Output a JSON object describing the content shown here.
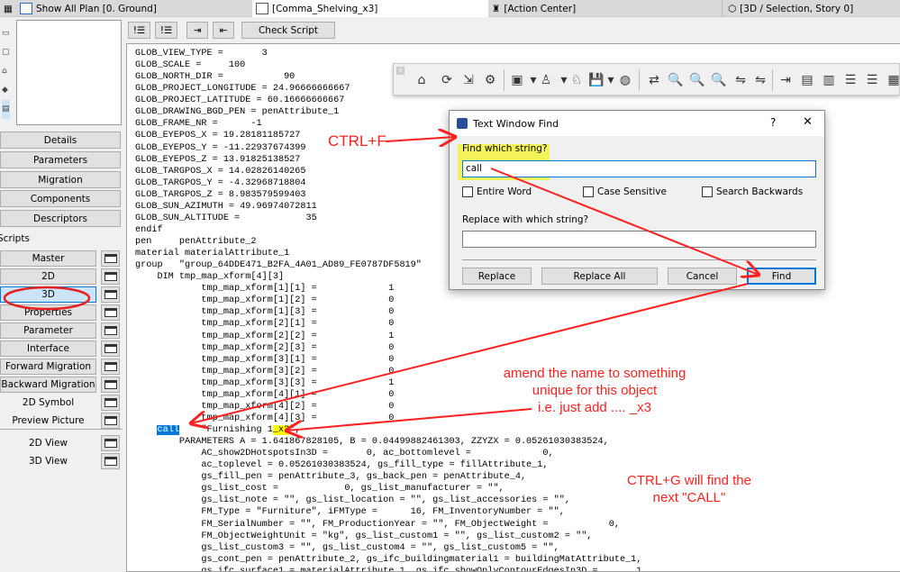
{
  "tabs": [
    {
      "label": "Show All Plan [0. Ground]",
      "icon": "floor-plan-icon"
    },
    {
      "label": "[Comma_Shelving_x3]",
      "icon": "gdl-object-icon",
      "active": true
    },
    {
      "label": "[Action Center]",
      "icon": "lighthouse-icon"
    },
    {
      "label": "[3D / Selection, Story 0]",
      "icon": "cube-icon"
    }
  ],
  "sidebar": {
    "sections": [
      "Details",
      "Parameters",
      "Migration",
      "Components",
      "Descriptors"
    ],
    "scripts_label": "Scripts",
    "scripts": [
      "Master",
      "2D",
      "3D",
      "Properties",
      "Parameter",
      "Interface",
      "Forward Migration",
      "Backward Migration",
      "2D Symbol",
      "Preview Picture"
    ],
    "selected_script": "3D",
    "views": [
      "2D View",
      "3D View"
    ]
  },
  "editor_toolbar": {
    "check_script": "Check Script"
  },
  "code": {
    "lines_before": [
      "GLOB_VIEW_TYPE =       3",
      "GLOB_SCALE =     100",
      "GLOB_NORTH_DIR =           90",
      "GLOB_PROJECT_LONGITUDE = 24.96666666667",
      "GLOB_PROJECT_LATITUDE = 60.16666666667",
      "GLOB_DRAWING_BGD_PEN = penAttribute_1",
      "GLOB_FRAME_NR =      -1",
      "GLOB_EYEPOS_X = 19.28181185727",
      "GLOB_EYEPOS_Y = -11.22937674399",
      "GLOB_EYEPOS_Z = 13.91825138527",
      "GLOB_TARGPOS_X = 14.02826140265",
      "GLOB_TARGPOS_Y = -4.32968718804",
      "GLOB_TARGPOS_Z = 8.983579599403",
      "GLOB_SUN_AZIMUTH = 49.96974072811",
      "GLOB_SUN_ALTITUDE =            35",
      "endif",
      "pen     penAttribute_2",
      "material materialAttribute_1",
      "group   \"group_64DDE471_B2FA_4A01_AD89_FE0787DF5819\"",
      "    DIM tmp_map_xform[4][3]",
      "            tmp_map_xform[1][1] =             1",
      "            tmp_map_xform[1][2] =             0",
      "            tmp_map_xform[1][3] =             0",
      "            tmp_map_xform[2][1] =             0",
      "            tmp_map_xform[2][2] =             1",
      "            tmp_map_xform[2][3] =             0",
      "            tmp_map_xform[3][1] =             0",
      "            tmp_map_xform[3][2] =             0",
      "            tmp_map_xform[3][3] =             1",
      "            tmp_map_xform[4][1] =             0",
      "            tmp_map_xform[4][2] =             0",
      "            tmp_map_xform[4][3] =             0"
    ],
    "call_line": {
      "indent": "    ",
      "keyword": "call",
      "mid": "    \"Furnishing 1",
      "highlight": "_x3",
      "end": "\","
    },
    "lines_after": [
      "        PARAMETERS A = 1.641867828105, B = 0.04499882461303, ZZYZX = 0.05261030383524,",
      "            AC_show2DHotspotsIn3D =       0, ac_bottomlevel =             0,",
      "            ac_toplevel = 0.05261030383524, gs_fill_type = fillAttribute_1,",
      "            gs_fill_pen = penAttribute_3, gs_back_pen = penAttribute_4,",
      "            gs_list_cost =            0, gs_list_manufacturer = \"\",",
      "            gs_list_note = \"\", gs_list_location = \"\", gs_list_accessories = \"\",",
      "            FM_Type = \"Furniture\", iFMType =      16, FM_InventoryNumber = \"\",",
      "            FM_SerialNumber = \"\", FM_ProductionYear = \"\", FM_ObjectWeight =           0,",
      "            FM_ObjectWeightUnit = \"kg\", gs_list_custom1 = \"\", gs_list_custom2 = \"\",",
      "            gs_list_custom3 = \"\", gs_list_custom4 = \"\", gs_list_custom5 = \"\",",
      "            gs_cont_pen = penAttribute_2, gs_ifc_buildingmaterial1 = buildingMatAttribute_1,",
      "            gs_ifc_surface1 = materialAttribute_1, gs_ifc_showOnlyContourEdgesIn3D =       1,"
    ]
  },
  "dialog": {
    "title": "Text Window Find",
    "help": "?",
    "close": "✕",
    "find_label": "Find which string?",
    "find_value": "call",
    "options": [
      "Entire Word",
      "Case Sensitive",
      "Search Backwards"
    ],
    "replace_label": "Replace with which string?",
    "replace_value": "",
    "buttons": {
      "replace": "Replace",
      "replace_all": "Replace All",
      "cancel": "Cancel",
      "find": "Find"
    }
  },
  "annotations": {
    "ctrl_f": "CTRL+F",
    "amend": [
      "amend the name to something",
      "unique for this object",
      "i.e. just add .... _x3"
    ],
    "ctrl_g": [
      "CTRL+G will find the",
      "next \"CALL\""
    ],
    "color": "#ff2020"
  },
  "colors": {
    "selection": "#0078d7",
    "highlight": "#ffff00",
    "annotation": "#ff2020"
  }
}
